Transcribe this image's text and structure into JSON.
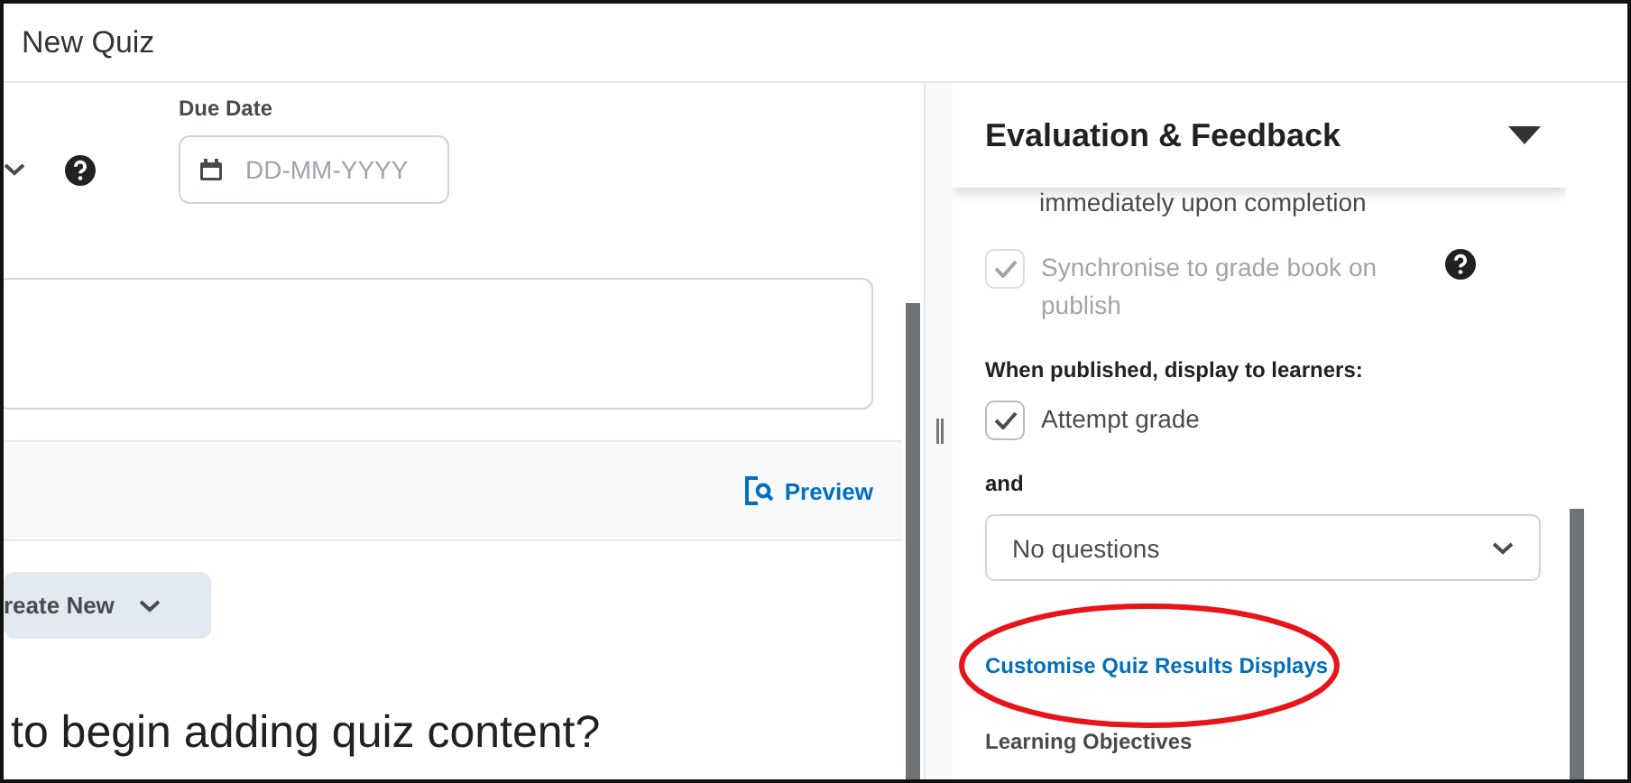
{
  "window": {
    "title": "New Quiz"
  },
  "left": {
    "due_date": {
      "label": "Due Date",
      "placeholder": "DD-MM-YYYY"
    },
    "preview": "Preview",
    "create_button": "reate New",
    "heading": "to begin adding quiz content?"
  },
  "panel": {
    "title": "Evaluation & Feedback",
    "expanded": true,
    "options": [
      {
        "kind": "text",
        "label": "immediately upon completion"
      },
      {
        "kind": "checkbox",
        "label": "Synchronise to grade book on publish",
        "checked": true,
        "disabled": true,
        "help": true
      }
    ],
    "display_label": "When published, display to learners:",
    "display_options": [
      {
        "label": "Attempt grade",
        "checked": true,
        "disabled": false
      }
    ],
    "and_label": "and",
    "select": {
      "value": "No questions"
    },
    "link": "Customise Quiz Results Displays",
    "next_section": "Learning Objectives"
  }
}
